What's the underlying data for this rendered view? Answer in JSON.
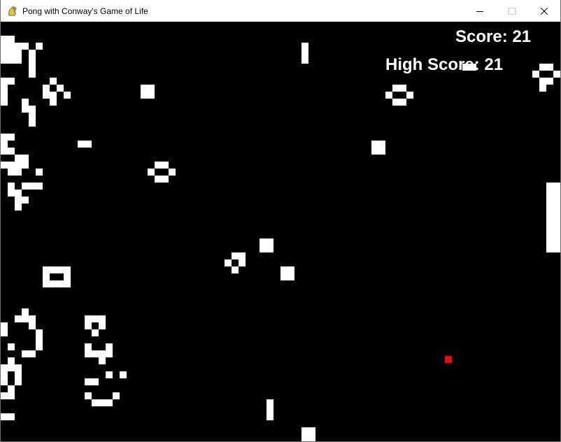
{
  "window": {
    "title": "Pong with Conway's Game of Life",
    "app_icon": "pygame-snake-icon",
    "controls": {
      "minimize": "minimize-icon",
      "maximize": "maximize-icon",
      "close": "close-icon"
    }
  },
  "hud": {
    "score_text": "Score: 21",
    "high_score_text": "High Score: 21"
  },
  "colors": {
    "background": "#000000",
    "cells": "#ffffff",
    "ball": "#ff0000",
    "paddle": "#ffffff"
  }
}
